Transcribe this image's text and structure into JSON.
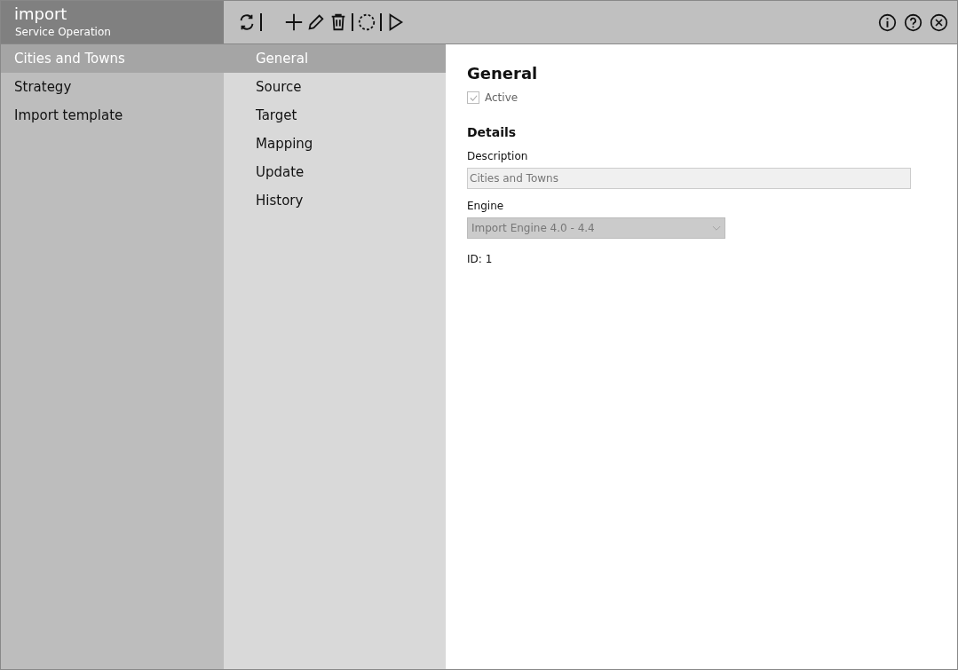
{
  "app": {
    "title": "import",
    "subtitle": "Service Operation"
  },
  "sidebar": {
    "items": [
      {
        "label": "Cities and Towns",
        "selected": true
      },
      {
        "label": "Strategy",
        "selected": false
      },
      {
        "label": "Import template",
        "selected": false
      }
    ]
  },
  "sections": [
    {
      "label": "General",
      "selected": true
    },
    {
      "label": "Source",
      "selected": false
    },
    {
      "label": "Target",
      "selected": false
    },
    {
      "label": "Mapping",
      "selected": false
    },
    {
      "label": "Update",
      "selected": false
    },
    {
      "label": "History",
      "selected": false
    }
  ],
  "form": {
    "heading": "General",
    "active": {
      "label": "Active",
      "checked": true,
      "disabled": true
    },
    "details_heading": "Details",
    "description": {
      "label": "Description",
      "value": "Cities and Towns",
      "disabled": true
    },
    "engine": {
      "label": "Engine",
      "value": "Import Engine 4.0 - 4.4",
      "disabled": true
    },
    "id_text": "ID: 1"
  }
}
